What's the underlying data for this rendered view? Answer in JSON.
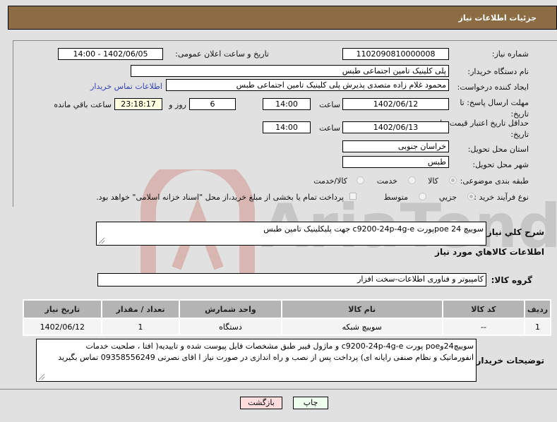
{
  "header": {
    "title": "جزئیات اطلاعات نیاز"
  },
  "form": {
    "need_number_label": "شماره نیاز:",
    "need_number": "1102090810000008",
    "announce_label": "تاریخ و ساعت اعلان عمومی:",
    "announce_value": "1402/06/05 - 14:00",
    "buyer_org_label": "نام دستگاه خریدار:",
    "buyer_org": "پلی کلینیک تامین اجتماعی طبس",
    "creator_label": "ایجاد کننده درخواست:",
    "creator": "محمود غلام زاده  متصدی پذیرش پلی کلینیک تامین اجتماعی طبس",
    "contact_link": "اطلاعات تماس خریدار",
    "reply_deadline_label_1": "مهلت ارسال پاسخ: تا",
    "reply_deadline_label_2": "تاریخ:",
    "reply_date": "1402/06/12",
    "time_label": "ساعت",
    "reply_time": "14:00",
    "days_value": "6",
    "days_label": "روز و",
    "remaining_time": "23:18:17",
    "remaining_label": "ساعت باقي مانده",
    "price_validity_label_1": "حداقل تاریخ اعتبار قیمت: تا",
    "price_validity_label_2": "تاریخ:",
    "price_validity_date": "1402/06/13",
    "price_validity_time": "14:00",
    "province_label": "استان محل تحویل:",
    "province": "خراسان جنوبی",
    "city_label": "شهر محل تحویل:",
    "city": "طبس",
    "category_label": "طبقه بندی موضوعی:",
    "category_options": [
      {
        "label": "کالا",
        "checked": true
      },
      {
        "label": "خدمت",
        "checked": false
      },
      {
        "label": "کالا/خدمت",
        "checked": false
      }
    ],
    "process_label": "نوع فرآیند خرید :",
    "process_options": [
      {
        "label": "جزيي",
        "checked": true
      },
      {
        "label": "متوسط",
        "checked": false
      }
    ],
    "treasury_checkbox_label": "پرداخت تمام یا بخشی از مبلغ خرید،از محل \"اسناد خزانه اسلامی\" خواهد بود."
  },
  "description": {
    "label": "شرح کلي نياز:",
    "value": "سوییچ 24 poeپورت c9200-24p-4g-e جهت پلیکلینیک تامین طبس"
  },
  "items_section": {
    "title": "اطلاعات کالاهاي مورد نياز",
    "group_label": "گروه کالا:",
    "group_value": "کامپیوتر و فناوری اطلاعات-سخت افزار"
  },
  "items_table": {
    "headers": [
      "ردیف",
      "کد کالا",
      "نام کالا",
      "واحد شمارش",
      "تعداد / مقدار",
      "تاریخ نیاز"
    ],
    "rows": [
      [
        "1",
        "--",
        "سوییچ شبکه",
        "دستگاه",
        "1",
        "1402/06/12"
      ]
    ]
  },
  "buyer_notes": {
    "label": "توضیحات خریدار:",
    "line1": "سوییچ24وpoe پورت c9200-24p-4g-e و ماژول فیبر طبق مشخصات فایل پیوست شده و تاییدیه( افتا ، صلحیت خدمات",
    "line2": "انفورماتیک و نظام صنفی رایانه ای) پرداخت پس از نصب و راه اندازی در صورت نیاز ا اقای نصرتی 09358556249 تماس بگیرید"
  },
  "buttons": {
    "print": "چاپ",
    "back": "بازگشت"
  },
  "watermark": {
    "text": "AriaTender.neT"
  },
  "colors": {
    "header_bg": "#8c6d43",
    "print_bg": "#eeffee",
    "back_bg": "#ffdddd",
    "link": "#3344bb"
  }
}
